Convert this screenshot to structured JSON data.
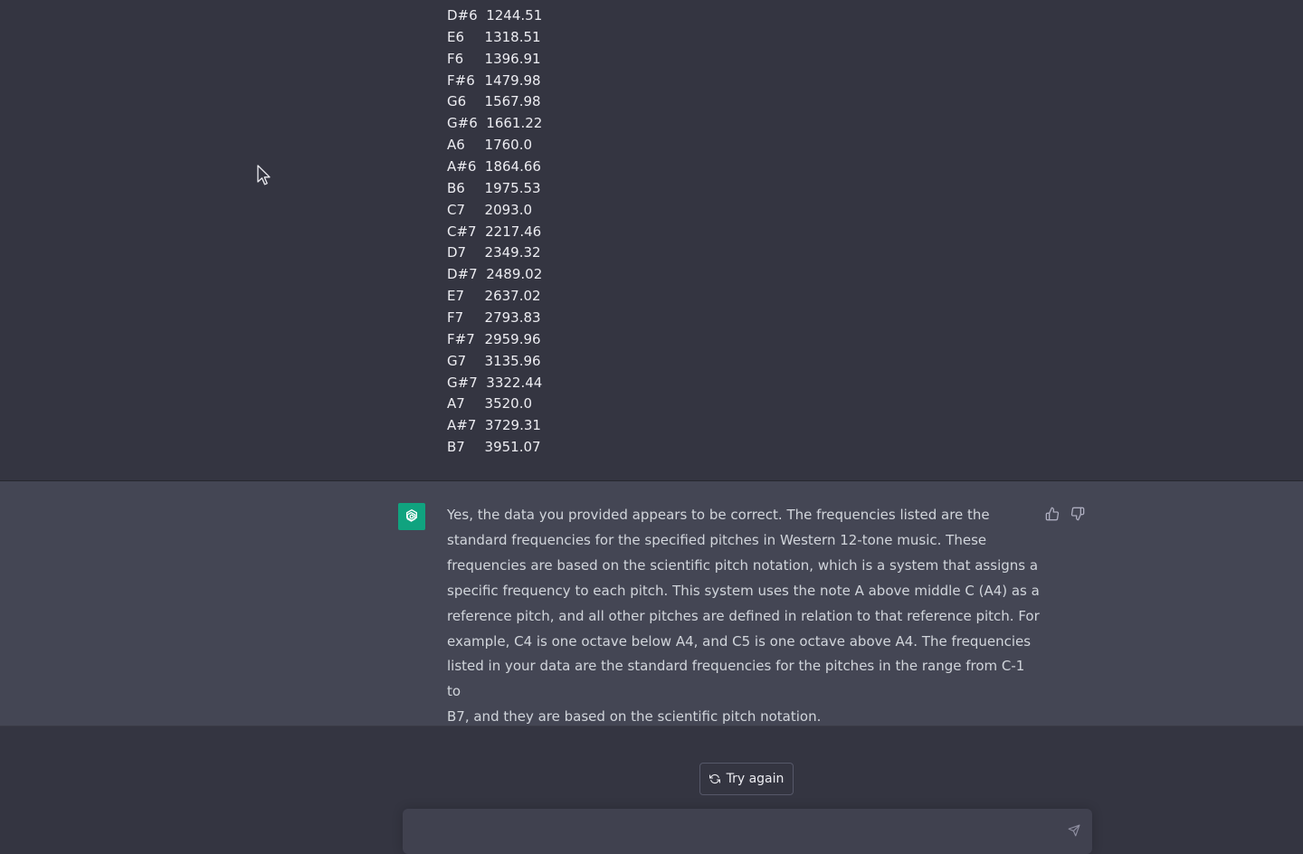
{
  "notes": [
    {
      "name": "D#6",
      "freq": "1244.51"
    },
    {
      "name": "E6",
      "freq": "1318.51"
    },
    {
      "name": "F6",
      "freq": "1396.91"
    },
    {
      "name": "F#6",
      "freq": "1479.98"
    },
    {
      "name": "G6",
      "freq": "1567.98"
    },
    {
      "name": "G#6",
      "freq": "1661.22"
    },
    {
      "name": "A6",
      "freq": "1760.0"
    },
    {
      "name": "A#6",
      "freq": "1864.66"
    },
    {
      "name": "B6",
      "freq": "1975.53"
    },
    {
      "name": "C7",
      "freq": "2093.0"
    },
    {
      "name": "C#7",
      "freq": "2217.46"
    },
    {
      "name": "D7",
      "freq": "2349.32"
    },
    {
      "name": "D#7",
      "freq": "2489.02"
    },
    {
      "name": "E7",
      "freq": "2637.02"
    },
    {
      "name": "F7",
      "freq": "2793.83"
    },
    {
      "name": "F#7",
      "freq": "2959.96"
    },
    {
      "name": "G7",
      "freq": "3135.96"
    },
    {
      "name": "G#7",
      "freq": "3322.44"
    },
    {
      "name": "A7",
      "freq": "3520.0"
    },
    {
      "name": "A#7",
      "freq": "3729.31"
    },
    {
      "name": "B7",
      "freq": "3951.07"
    }
  ],
  "assistant": {
    "lines": [
      "Yes, the data you provided appears to be correct. The frequencies listed are the",
      "standard frequencies for the specified pitches in Western 12-tone music. These",
      "frequencies are based on the scientific pitch notation, which is a system that assigns a",
      "specific frequency to each pitch. This system uses the note A above middle C (A4) as a",
      "reference pitch, and all other pitches are defined in relation to that reference pitch. For",
      "example, C4 is one octave below A4, and C5 is one octave above A4. The frequencies",
      "listed in your data are the standard frequencies for the pitches in the range from C-1 to",
      "B7, and they are based on the scientific pitch notation."
    ],
    "avatar_icon": "openai-logo-icon",
    "avatar_color": "#10a37f"
  },
  "feedback": {
    "up_icon": "thumbs-up-icon",
    "down_icon": "thumbs-down-icon"
  },
  "controls": {
    "try_again_label": "Try again",
    "try_again_icon": "refresh-icon",
    "input_value": "",
    "send_icon": "send-icon"
  },
  "colors": {
    "page_background": "#343541",
    "assistant_background": "#444654",
    "text": "#ececf1"
  }
}
